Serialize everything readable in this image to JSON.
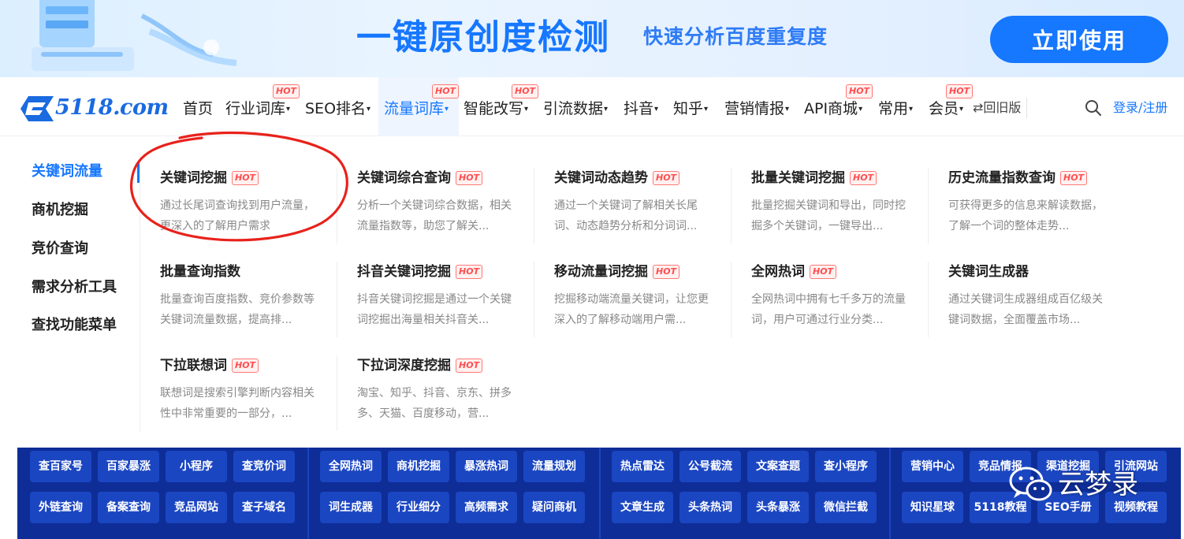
{
  "banner": {
    "title": "一键原创度检测",
    "subtitle": "快速分析百度重复度",
    "cta_label": "立即使用"
  },
  "logo": {
    "text": "5118.com"
  },
  "nav": {
    "items": [
      {
        "label": "首页",
        "dropdown": false,
        "hot": false,
        "active": false
      },
      {
        "label": "行业词库",
        "dropdown": true,
        "hot": true,
        "active": false
      },
      {
        "label": "SEO排名",
        "dropdown": true,
        "hot": false,
        "active": false
      },
      {
        "label": "流量词库",
        "dropdown": true,
        "hot": true,
        "active": true
      },
      {
        "label": "智能改写",
        "dropdown": true,
        "hot": true,
        "active": false
      },
      {
        "label": "引流数据",
        "dropdown": true,
        "hot": false,
        "active": false
      },
      {
        "label": "抖音",
        "dropdown": true,
        "hot": false,
        "active": false
      },
      {
        "label": "知乎",
        "dropdown": true,
        "hot": false,
        "active": false
      },
      {
        "label": "营销情报",
        "dropdown": true,
        "hot": false,
        "active": false
      },
      {
        "label": "API商城",
        "dropdown": true,
        "hot": true,
        "active": false
      },
      {
        "label": "常用",
        "dropdown": true,
        "hot": false,
        "active": false
      },
      {
        "label": "会员",
        "dropdown": true,
        "hot": true,
        "active": false
      }
    ],
    "hot_label": "HOT",
    "old_version": "⇄回旧版",
    "login": "登录/注册",
    "caret": "▾"
  },
  "sidebar": {
    "items": [
      {
        "label": "关键词流量",
        "active": true
      },
      {
        "label": "商机挖掘",
        "active": false
      },
      {
        "label": "竞价查询",
        "active": false
      },
      {
        "label": "需求分析工具",
        "active": false
      },
      {
        "label": "查找功能菜单",
        "active": false
      }
    ]
  },
  "cards": [
    {
      "title": "关键词挖掘",
      "hot": true,
      "desc": "通过长尾词查询找到用户流量，更深入的了解用户需求"
    },
    {
      "title": "关键词综合查询",
      "hot": true,
      "desc": "分析一个关键词综合数据，相关流量指数等，助您了解关..."
    },
    {
      "title": "关键词动态趋势",
      "hot": true,
      "desc": "通过一个关键词了解相关长尾词、动态趋势分析和分词词..."
    },
    {
      "title": "批量关键词挖掘",
      "hot": true,
      "desc": "批量挖掘关键词和导出，同时挖掘多个关键词，一键导出..."
    },
    {
      "title": "历史流量指数查询",
      "hot": true,
      "desc": "可获得更多的信息来解读数据，了解一个词的整体走势..."
    },
    {
      "title": "批量查询指数",
      "hot": false,
      "desc": "批量查询百度指数、竞价参数等关键词流量数据，提高排..."
    },
    {
      "title": "抖音关键词挖掘",
      "hot": true,
      "desc": "抖音关键词挖掘是通过一个关键词挖掘出海量相关抖音关..."
    },
    {
      "title": "移动流量词挖掘",
      "hot": true,
      "desc": "挖掘移动端流量关键词，让您更深入的了解移动端用户需..."
    },
    {
      "title": "全网热词",
      "hot": true,
      "desc": "全网热词中拥有七千多万的流量词，用户可通过行业分类..."
    },
    {
      "title": "关键词生成器",
      "hot": false,
      "desc": "通过关键词生成器组成百亿级关键词数据，全面覆盖市场..."
    },
    {
      "title": "下拉联想词",
      "hot": true,
      "desc": "联想词是搜索引擎判断内容相关性中非常重要的一部分，..."
    },
    {
      "title": "下拉词深度挖掘",
      "hot": true,
      "desc": "淘宝、知乎、抖音、京东、拼多多、天猫、百度移动，营..."
    }
  ],
  "quick_links": {
    "groups": [
      [
        "查百家号",
        "百家暴涨",
        "小程序",
        "查竞价词",
        "外链查询",
        "备案查询",
        "竞品网站",
        "查子域名"
      ],
      [
        "全网热词",
        "商机挖掘",
        "暴涨热词",
        "流量规划",
        "词生成器",
        "行业细分",
        "高频需求",
        "疑问商机"
      ],
      [
        "热点雷达",
        "公号截流",
        "文案查题",
        "查小程序",
        "文章生成",
        "头条热词",
        "头条暴涨",
        "微信拦截"
      ],
      [
        "营销中心",
        "竞品情报",
        "渠道挖掘",
        "引流网站",
        "知识星球",
        "5118教程",
        "SEO手册",
        "视频教程"
      ]
    ]
  },
  "watermark": {
    "text": "云梦录",
    "icon": "wechat-icon"
  },
  "colors": {
    "accent": "#1677ff",
    "hot": "#ff4d4f",
    "bottom_bar": "#0e2d96",
    "annotation": "#e8221b"
  }
}
